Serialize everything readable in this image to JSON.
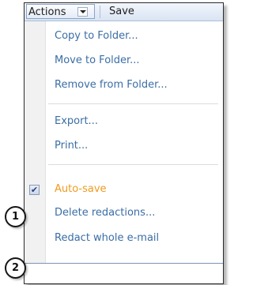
{
  "toolbar": {
    "actions_label": "Actions",
    "save_label": "Save"
  },
  "menu": {
    "copy": "Copy to Folder...",
    "move": "Move to Folder...",
    "remove": "Remove from Folder...",
    "export": "Export...",
    "print": "Print...",
    "autosave": "Auto-save",
    "autosave_checked": true,
    "delete_redactions": "Delete redactions...",
    "redact_email": "Redact whole e-mail"
  },
  "callouts": {
    "one": "1",
    "two": "2"
  },
  "colors": {
    "link": "#3a6ea5",
    "highlight": "#ef9b1f",
    "gutter": "#f1f1f1"
  }
}
